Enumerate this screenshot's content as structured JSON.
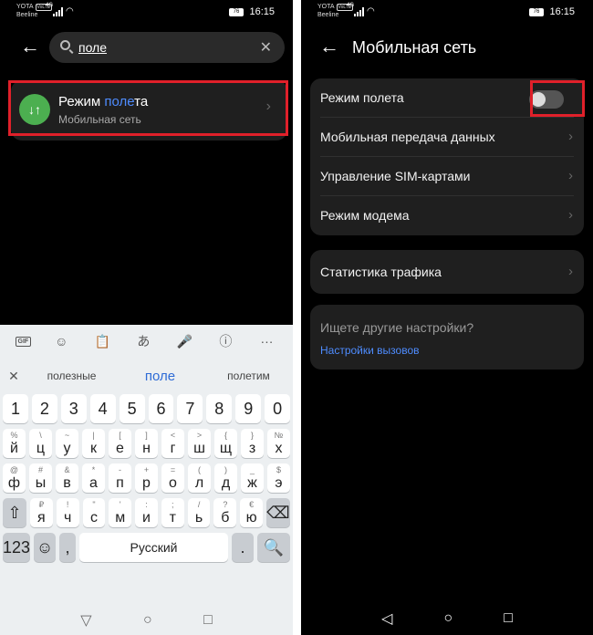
{
  "left": {
    "status": {
      "carrier_top": "YOTA",
      "carrier_badge": "VoLTE",
      "carrier_bottom": "Beeline",
      "network": "4G",
      "battery": "76",
      "time": "16:15"
    },
    "search": {
      "back_icon": "arrow-left-icon",
      "query": "поле",
      "clear_icon": "close-icon"
    },
    "result": {
      "title_prefix": "Режим ",
      "title_highlight": "поле",
      "title_suffix": "та",
      "subtitle": "Мобильная сеть",
      "icon_text": "↓↑"
    },
    "keyboard": {
      "tools": [
        "GIF",
        "☺",
        "📋",
        "あ",
        "🎤",
        "ⓘ",
        "···"
      ],
      "suggestions": [
        "полезные",
        "поле",
        "полетим"
      ],
      "number_row": [
        "1",
        "2",
        "3",
        "4",
        "5",
        "6",
        "7",
        "8",
        "9",
        "0"
      ],
      "row1": [
        [
          "%",
          "й"
        ],
        [
          "\\",
          "ц"
        ],
        [
          "~",
          "у"
        ],
        [
          "|",
          "к"
        ],
        [
          "[",
          "е"
        ],
        [
          "]",
          "н"
        ],
        [
          "<",
          "г"
        ],
        [
          ">",
          "ш"
        ],
        [
          "{",
          "щ"
        ],
        [
          "}",
          "з"
        ],
        [
          "№",
          "х"
        ]
      ],
      "row2": [
        [
          "@",
          "ф"
        ],
        [
          "#",
          "ы"
        ],
        [
          "&",
          "в"
        ],
        [
          "*",
          "а"
        ],
        [
          "-",
          "п"
        ],
        [
          "+",
          "р"
        ],
        [
          "=",
          "о"
        ],
        [
          "(",
          "л"
        ],
        [
          ")",
          "д"
        ],
        [
          "_",
          "ж"
        ],
        [
          "$",
          "э"
        ]
      ],
      "row3": [
        [
          "₽",
          "я"
        ],
        [
          "!",
          "ч"
        ],
        [
          "\"",
          "с"
        ],
        [
          "'",
          "м"
        ],
        [
          ":",
          "и"
        ],
        [
          ";",
          "т"
        ],
        [
          "/",
          "ь"
        ],
        [
          "?",
          "б"
        ],
        [
          "€",
          "ю"
        ]
      ],
      "shift": "⇧",
      "backspace": "⌫",
      "sym": "123",
      "emoji": "☺",
      "comma": ",",
      "space": "Русский",
      "period": ".",
      "search_key": "🔍"
    },
    "nav": [
      "▽",
      "○",
      "□"
    ]
  },
  "right": {
    "status": {
      "carrier_top": "YOTA",
      "carrier_badge": "VoLTE",
      "carrier_bottom": "Beeline",
      "network": "4G",
      "battery": "76",
      "time": "16:15"
    },
    "title": "Мобильная сеть",
    "airplane_mode": {
      "label": "Режим полета",
      "enabled": false
    },
    "items": [
      "Мобильная передача данных",
      "Управление SIM-картами",
      "Режим модема"
    ],
    "traffic": "Статистика трафика",
    "other": {
      "question": "Ищете другие настройки?",
      "link": "Настройки вызовов"
    },
    "nav": [
      "◁",
      "○",
      "□"
    ]
  },
  "colors": {
    "accent": "#4e8cff",
    "highlight_box": "#e0202a",
    "result_icon": "#4caf50"
  }
}
